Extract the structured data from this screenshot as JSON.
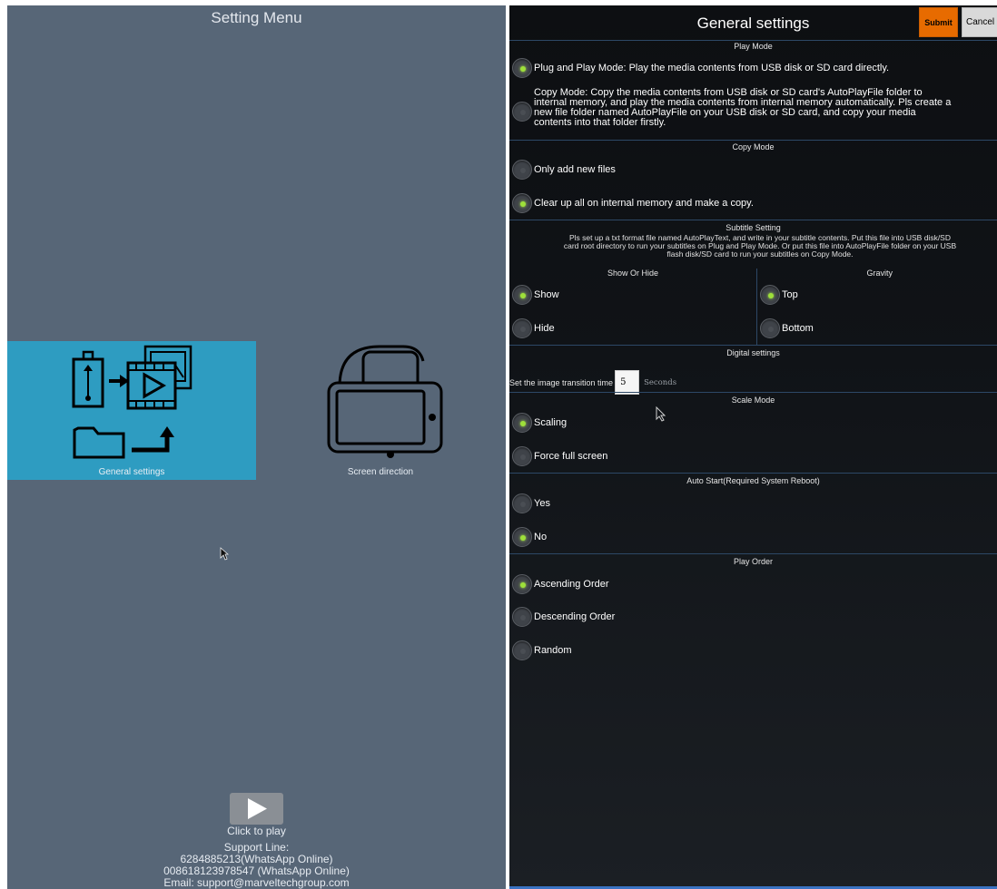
{
  "left_panel": {
    "title": "Setting Menu",
    "tiles": [
      {
        "label": "General settings",
        "icon": "media-transfer-icon",
        "selected": true
      },
      {
        "label": "Screen direction",
        "icon": "screen-rotate-icon",
        "selected": false
      }
    ],
    "play_label": "Click to play",
    "support": [
      "Support Line:",
      "6284885213(WhatsApp Online)",
      "008618123978547 (WhatsApp Online)",
      "Email: support@marveltechgroup.com"
    ],
    "colors": {
      "background": "#576677",
      "selected_tile": "#2e9cc1"
    }
  },
  "right_panel": {
    "title": "General settings",
    "submit_label": "Submit",
    "cancel_label": "Cancel",
    "play_mode": {
      "heading": "Play Mode",
      "plug_option": "Plug and Play Mode: Play the media contents from USB disk or SD card directly.",
      "copy_option_lines": [
        "Copy Mode: Copy the media contents from USB disk or SD card's AutoPlayFile folder to",
        "internal memory, and play the media contents from internal memory automatically. Pls create a",
        "new file folder named AutoPlayFile on your USB disk or SD card, and copy your media",
        "contents into that folder firstly."
      ],
      "selected": "plug"
    },
    "copy_mode": {
      "heading": "Copy Mode",
      "options": [
        "Only add new files",
        "Clear up all on internal memory and make a copy."
      ],
      "selected_index": 1
    },
    "subtitle": {
      "heading": "Subtitle Setting",
      "description_lines": [
        "Pls set up a txt format file named AutoPlayText, and write in your subtitle contents. Put this file into USB disk/SD",
        "card root directory to run your subtitles on Plug and Play Mode. Or put this file into AutoPlayFile folder on your USB",
        "flash disk/SD card to run your subtitles on Copy Mode."
      ],
      "show_hide_heading": "Show Or Hide",
      "show_hide_options": [
        "Show",
        "Hide"
      ],
      "show_hide_selected": 0,
      "gravity_heading": "Gravity",
      "gravity_options": [
        "Top",
        "Bottom"
      ],
      "gravity_selected": 0
    },
    "digital": {
      "heading": "Digital settings",
      "label": "Set the image transition time",
      "value": "5",
      "unit": "Seconds"
    },
    "scale_mode": {
      "heading": "Scale Mode",
      "options": [
        "Scaling",
        "Force full screen"
      ],
      "selected_index": 0
    },
    "auto_start": {
      "heading": "Auto Start(Required System Reboot)",
      "options": [
        "Yes",
        "No"
      ],
      "selected_index": 1
    },
    "play_order": {
      "heading": "Play Order",
      "options": [
        "Ascending Order",
        "Descending Order",
        "Random"
      ],
      "selected_index": 0
    },
    "colors": {
      "submit": "#e76b00",
      "cancel": "#d9d9d9",
      "radio_on": "#9ee03a",
      "divider": "#2d4866"
    }
  }
}
